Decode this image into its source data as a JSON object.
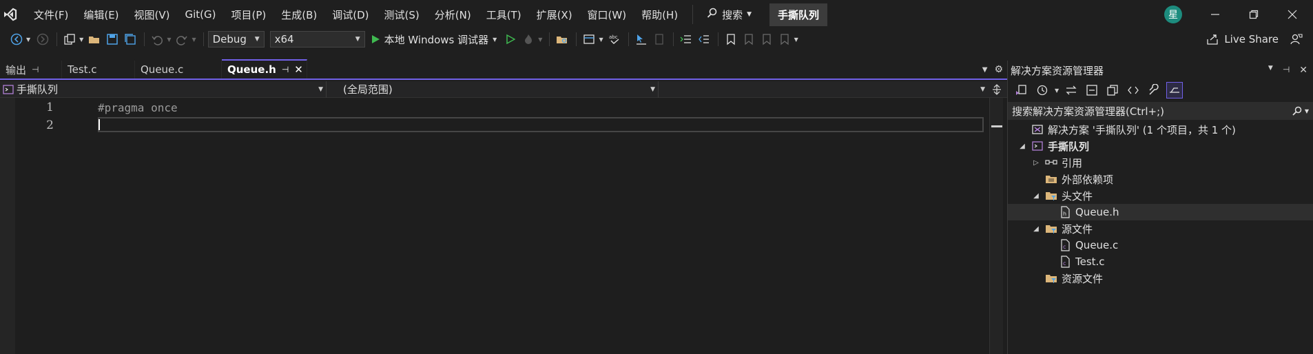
{
  "menubar": {
    "items": [
      "文件(F)",
      "编辑(E)",
      "视图(V)",
      "Git(G)",
      "项目(P)",
      "生成(B)",
      "调试(D)",
      "测试(S)",
      "分析(N)",
      "工具(T)",
      "扩展(X)",
      "窗口(W)",
      "帮助(H)"
    ],
    "search_label": "搜索",
    "project_name": "手撕队列",
    "avatar_initial": "星"
  },
  "toolbar": {
    "config": "Debug",
    "platform": "x64",
    "run_label": "本地 Windows 调试器",
    "live_share": "Live Share"
  },
  "tabs": [
    {
      "label": "输出",
      "active": false
    },
    {
      "label": "Test.c",
      "active": false
    },
    {
      "label": "Queue.c",
      "active": false
    },
    {
      "label": "Queue.h",
      "active": true
    }
  ],
  "navbar": {
    "project": "手撕队列",
    "scope": "(全局范围)",
    "member": ""
  },
  "editor": {
    "lines": [
      {
        "num": "1",
        "code": "#pragma once"
      },
      {
        "num": "2",
        "code": ""
      }
    ]
  },
  "solution_explorer": {
    "title": "解决方案资源管理器",
    "search_placeholder": "搜索解决方案资源管理器(Ctrl+;)",
    "tree": [
      {
        "label": "解决方案 '手撕队列' (1 个项目，共 1 个)",
        "icon": "solution-icon",
        "depth": 0,
        "expander": ""
      },
      {
        "label": "手撕队列",
        "icon": "project-icon",
        "depth": 0,
        "expander": "◢",
        "bold": true
      },
      {
        "label": "引用",
        "icon": "references-icon",
        "depth": 1,
        "expander": "▷"
      },
      {
        "label": "外部依赖项",
        "icon": "folder-icon",
        "depth": 1,
        "expander": ""
      },
      {
        "label": "头文件",
        "icon": "filter-folder-icon",
        "depth": 1,
        "expander": "◢"
      },
      {
        "label": "Queue.h",
        "icon": "header-file-icon",
        "depth": 2,
        "expander": "",
        "selected": true
      },
      {
        "label": "源文件",
        "icon": "filter-folder-icon",
        "depth": 1,
        "expander": "◢"
      },
      {
        "label": "Queue.c",
        "icon": "c-file-icon",
        "depth": 2,
        "expander": ""
      },
      {
        "label": "Test.c",
        "icon": "c-file-icon",
        "depth": 2,
        "expander": ""
      },
      {
        "label": "资源文件",
        "icon": "filter-folder-icon",
        "depth": 1,
        "expander": ""
      }
    ]
  },
  "colors": {
    "accent": "#7160e8",
    "run_green": "#3fb950",
    "folder": "#dcb67a",
    "avatar_bg": "#1d8c7e"
  }
}
